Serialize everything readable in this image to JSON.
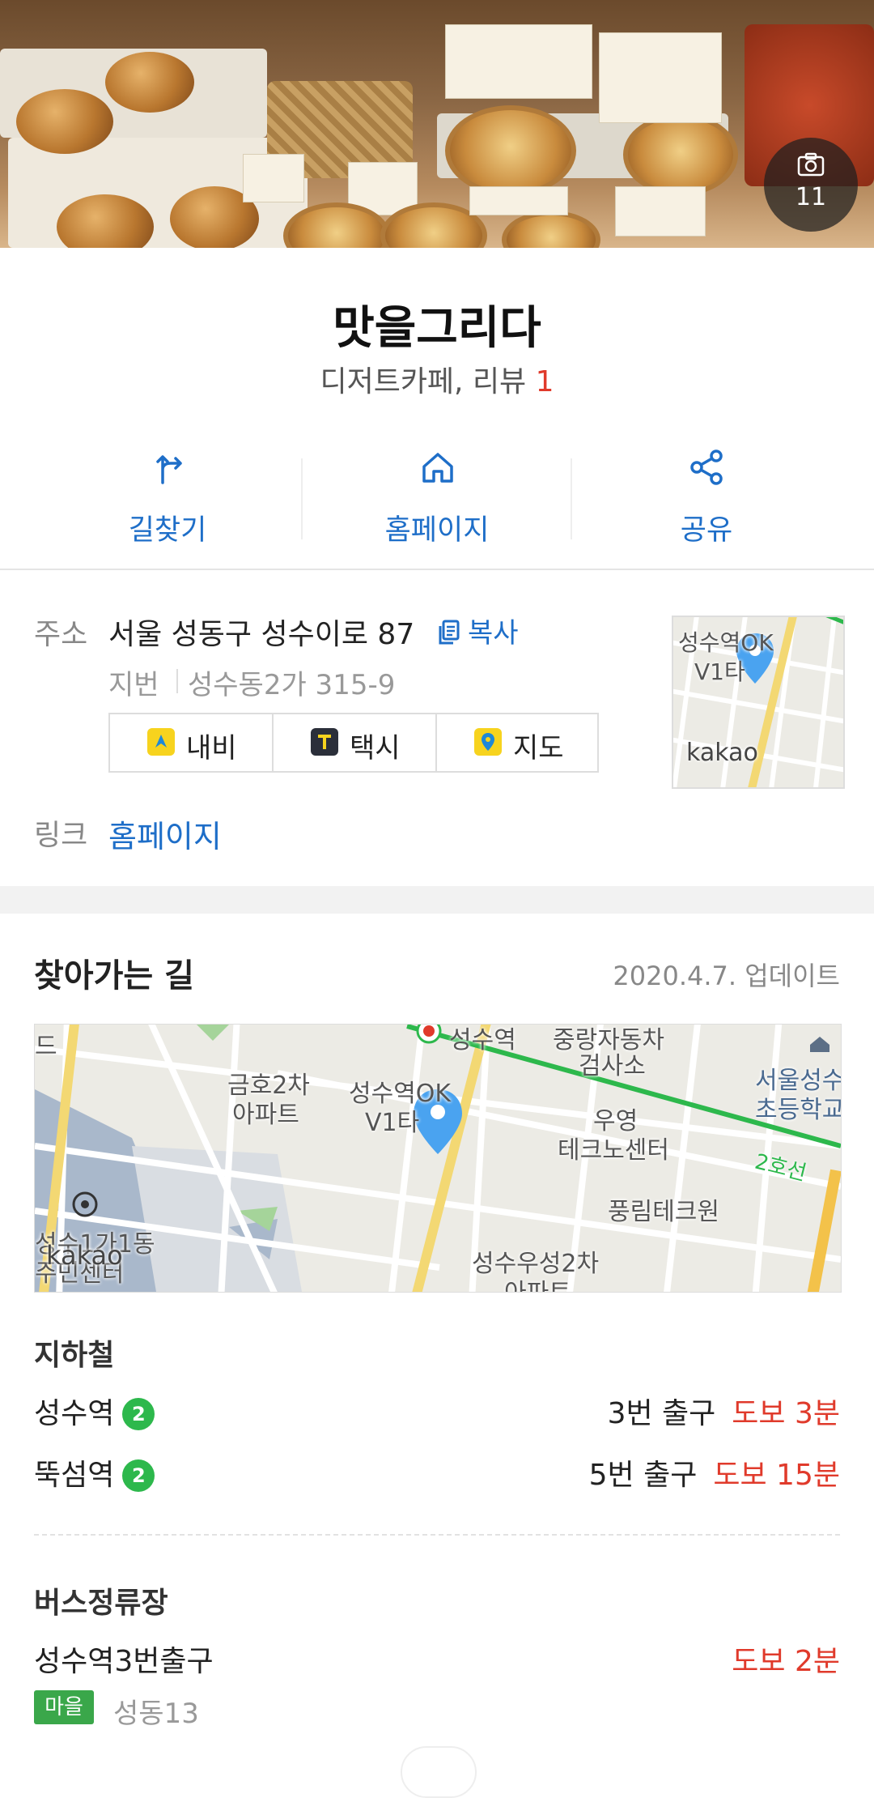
{
  "hero": {
    "photo_count": "11"
  },
  "place": {
    "name": "맛을그리다",
    "category": "디저트카페, 리뷰",
    "review_count": "1"
  },
  "actions": [
    {
      "label": "길찾기",
      "icon": "route-icon"
    },
    {
      "label": "홈페이지",
      "icon": "home-icon"
    },
    {
      "label": "공유",
      "icon": "share-icon"
    }
  ],
  "info": {
    "address_label": "주소",
    "address": "서울 성동구 성수이로 87",
    "copy_label": "복사",
    "jibun_label": "지번",
    "jibun": "성수동2가 315-9",
    "nav_buttons": [
      {
        "label": "내비",
        "color": "#f7d31e"
      },
      {
        "label": "택시",
        "color": "#2b2f3a"
      },
      {
        "label": "지도",
        "color": "#f7d31e"
      }
    ],
    "link_label": "링크",
    "link_value": "홈페이지",
    "mini_map": {
      "labels": [
        "성수역OK",
        "V1타",
        "kakao"
      ]
    }
  },
  "directions": {
    "title": "찾아가는 길",
    "updated": "2020.4.7. 업데이트",
    "map_labels": [
      "성수역",
      "중랑자동차",
      "검사소",
      "금호2차",
      "아파트",
      "성수역OK",
      "V1타",
      "우영",
      "테크노센터",
      "2호선",
      "서울성수",
      "초등학교",
      "풍림테크원",
      "성수1가1동",
      "주민센터",
      "kakao",
      "성수우성2차",
      "아파트",
      "드"
    ],
    "subway_title": "지하철",
    "subway": [
      {
        "name": "성수역",
        "line": "2",
        "exit": "3번 출구",
        "walk": "도보 3분"
      },
      {
        "name": "뚝섬역",
        "line": "2",
        "exit": "5번 출구",
        "walk": "도보 15분"
      }
    ],
    "bus_title": "버스정류장",
    "bus_stop": {
      "name": "성수역3번출구",
      "walk": "도보 2분",
      "tag": "마을",
      "route": "성동13"
    }
  },
  "colors": {
    "accent": "#1e6ec8",
    "red": "#e03a2b",
    "line2": "#2db84c",
    "village_bus": "#3aa74a"
  }
}
